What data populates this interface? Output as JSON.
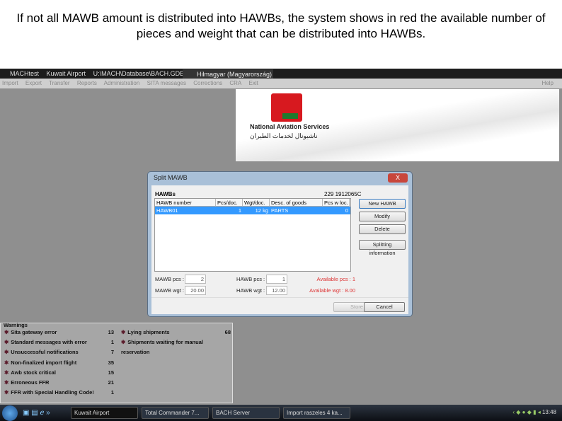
{
  "caption": "If not all MAWB amount is distributed into HAWBs, the system shows in red the available number of pieces and weight that can be distributed into HAWBs.",
  "titlebar": {
    "app": "MACHtest",
    "airport": "Kuwait Airport",
    "path": "U:\\MACH\\Database\\BACH.GDB",
    "user": "Hilmagyar (Magyarország)",
    "help_icon": "?"
  },
  "menu": [
    "Import",
    "Export",
    "Transfer",
    "Reports",
    "Administration",
    "SITA messages",
    "Corrections",
    "CRA",
    "Exit"
  ],
  "menu_help": "Help",
  "logo": {
    "name": "National Aviation Services",
    "arabic": "ناشيونال لخدمات الطيران"
  },
  "dialog": {
    "title": "Split MAWB",
    "close": "X",
    "section": "HAWBs",
    "mawb_number": "229 1912065C",
    "columns": [
      "HAWB number",
      "Pcs/doc.",
      "Wgt/doc.",
      "Desc. of goods",
      "Pcs w loc."
    ],
    "rows": [
      [
        "HAWB01",
        "1",
        "12 kg",
        "PARTS",
        "0"
      ]
    ],
    "buttons": {
      "new": "New HAWB",
      "modify": "Modify",
      "delete": "Delete",
      "splitting": "Splitting information",
      "store": "Store",
      "cancel": "Cancel"
    },
    "mawb_pcs_label": "MAWB pcs :",
    "mawb_pcs": "2",
    "mawb_wgt_label": "MAWB wgt :",
    "mawb_wgt": "20.00",
    "hawb_pcs_label": "HAWB pcs :",
    "hawb_pcs": "1",
    "hawb_wgt_label": "HAWB wgt :",
    "hawb_wgt": "12.00",
    "available_pcs": "Available pcs : 1",
    "available_wgt": "Available wgt : 8.00"
  },
  "warnings": {
    "title": "Warnings",
    "left": [
      {
        "label": "Sita gateway error",
        "n": "13"
      },
      {
        "label": "Standard messages with error",
        "n": "1"
      },
      {
        "label": "Unsuccessful notifications",
        "n": "7"
      },
      {
        "label": "Non-finalized import flight",
        "n": "35"
      },
      {
        "label": "Awb stock critical",
        "n": "15"
      },
      {
        "label": "Erroneous FFR",
        "n": "21"
      },
      {
        "label": "FFR with Special Handling Code!",
        "n": "1"
      }
    ],
    "right": [
      {
        "label": "Lying shipments",
        "n": "68"
      },
      {
        "label": "Shipments waiting for manual reservation",
        "n": ""
      }
    ]
  },
  "taskbar": {
    "tasks": [
      "Kuwait Airport",
      "Total Commander 7...",
      "BACH Server",
      "Import raszeles 4 ka..."
    ],
    "clock": "13:48"
  }
}
